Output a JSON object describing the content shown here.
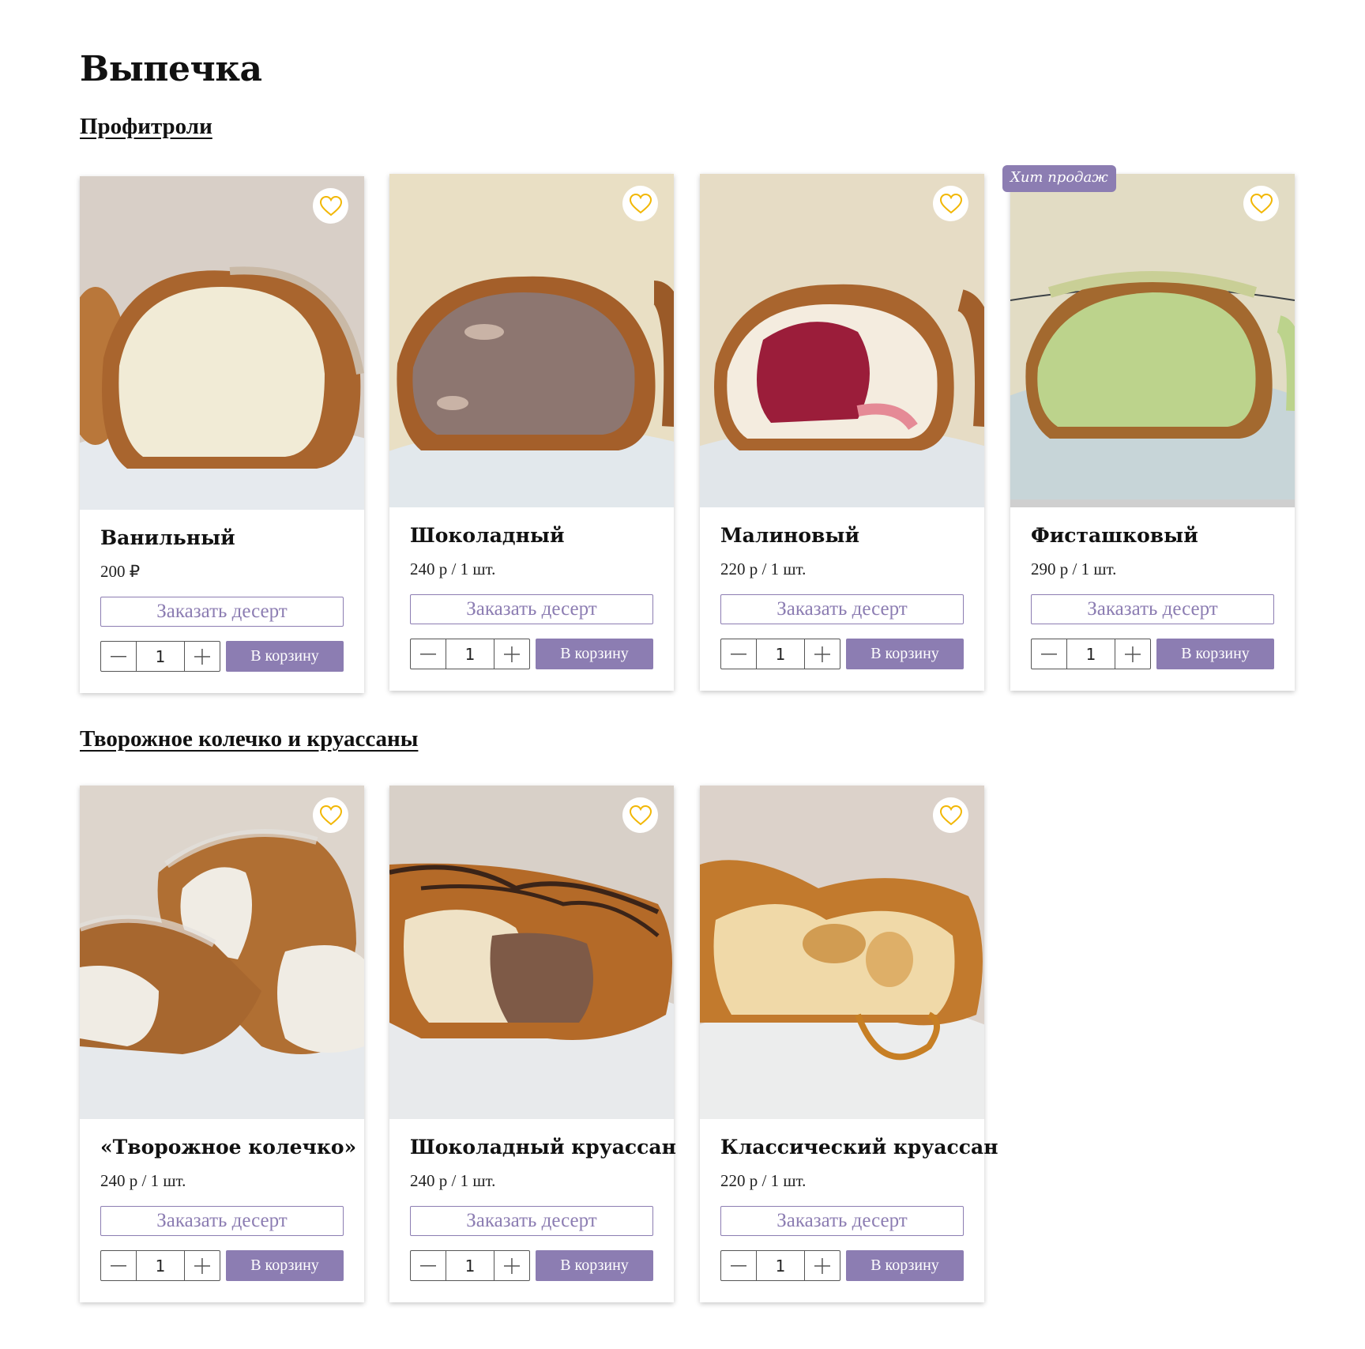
{
  "page": {
    "title": "Выпечка"
  },
  "colors": {
    "accent": "#8c7db2",
    "heart": "#f2b705",
    "text": "#111111"
  },
  "icons": {
    "favorite": "heart-icon",
    "decrease": "minus-icon",
    "increase": "plus-icon"
  },
  "common": {
    "order_label": "Заказать десерт",
    "cart_label": "В корзину",
    "default_qty": "1"
  },
  "sections": [
    {
      "title": "Профитроли",
      "products": [
        {
          "name": "Ванильный",
          "price": "200 ₽",
          "badge": "",
          "photo": "vanilla-profiterole"
        },
        {
          "name": "Шоколадный",
          "price": "240 р / 1 шт.",
          "badge": "",
          "photo": "chocolate-profiterole"
        },
        {
          "name": "Малиновый",
          "price": "220 р / 1 шт.",
          "badge": "",
          "photo": "raspberry-profiterole"
        },
        {
          "name": "Фисташковый",
          "price": "290 р / 1 шт.",
          "badge": "Хит продаж",
          "photo": "pistachio-profiterole"
        }
      ]
    },
    {
      "title": "Творожное колечко и круассаны",
      "products": [
        {
          "name": "«Творожное колечко»",
          "price": "240 р / 1 шт.",
          "badge": "",
          "photo": "curd-ring"
        },
        {
          "name": "Шоколадный круассан",
          "price": "240 р / 1 шт.",
          "badge": "",
          "photo": "chocolate-croissant"
        },
        {
          "name": "Классический круассан",
          "price": "220 р / 1 шт.",
          "badge": "",
          "photo": "classic-croissant"
        }
      ]
    }
  ]
}
